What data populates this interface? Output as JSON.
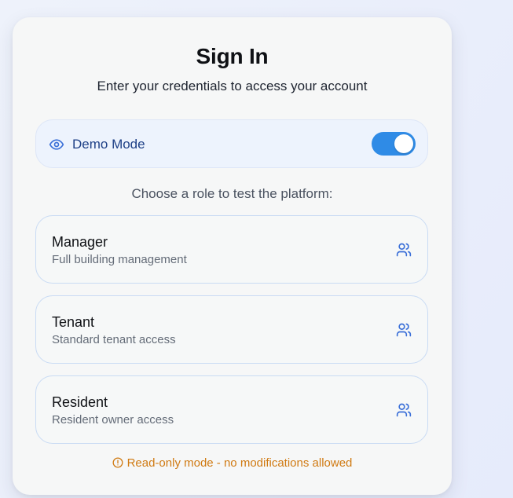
{
  "signin": {
    "title": "Sign In",
    "subtitle": "Enter your credentials to access your account"
  },
  "demo": {
    "label": "Demo Mode",
    "enabled": true,
    "icon": "eye-icon"
  },
  "role_prompt": "Choose a role to test the platform:",
  "roles": [
    {
      "name": "Manager",
      "description": "Full building management",
      "icon": "users-icon"
    },
    {
      "name": "Tenant",
      "description": "Standard tenant access",
      "icon": "users-icon"
    },
    {
      "name": "Resident",
      "description": "Resident owner access",
      "icon": "users-icon"
    }
  ],
  "notice": {
    "text": "Read-only mode - no modifications allowed",
    "icon": "alert-circle-icon"
  },
  "colors": {
    "accent": "#2f8be6",
    "demo_label": "#1d3f86",
    "icon_blue": "#3a6fd8",
    "warning": "#d07a12"
  }
}
